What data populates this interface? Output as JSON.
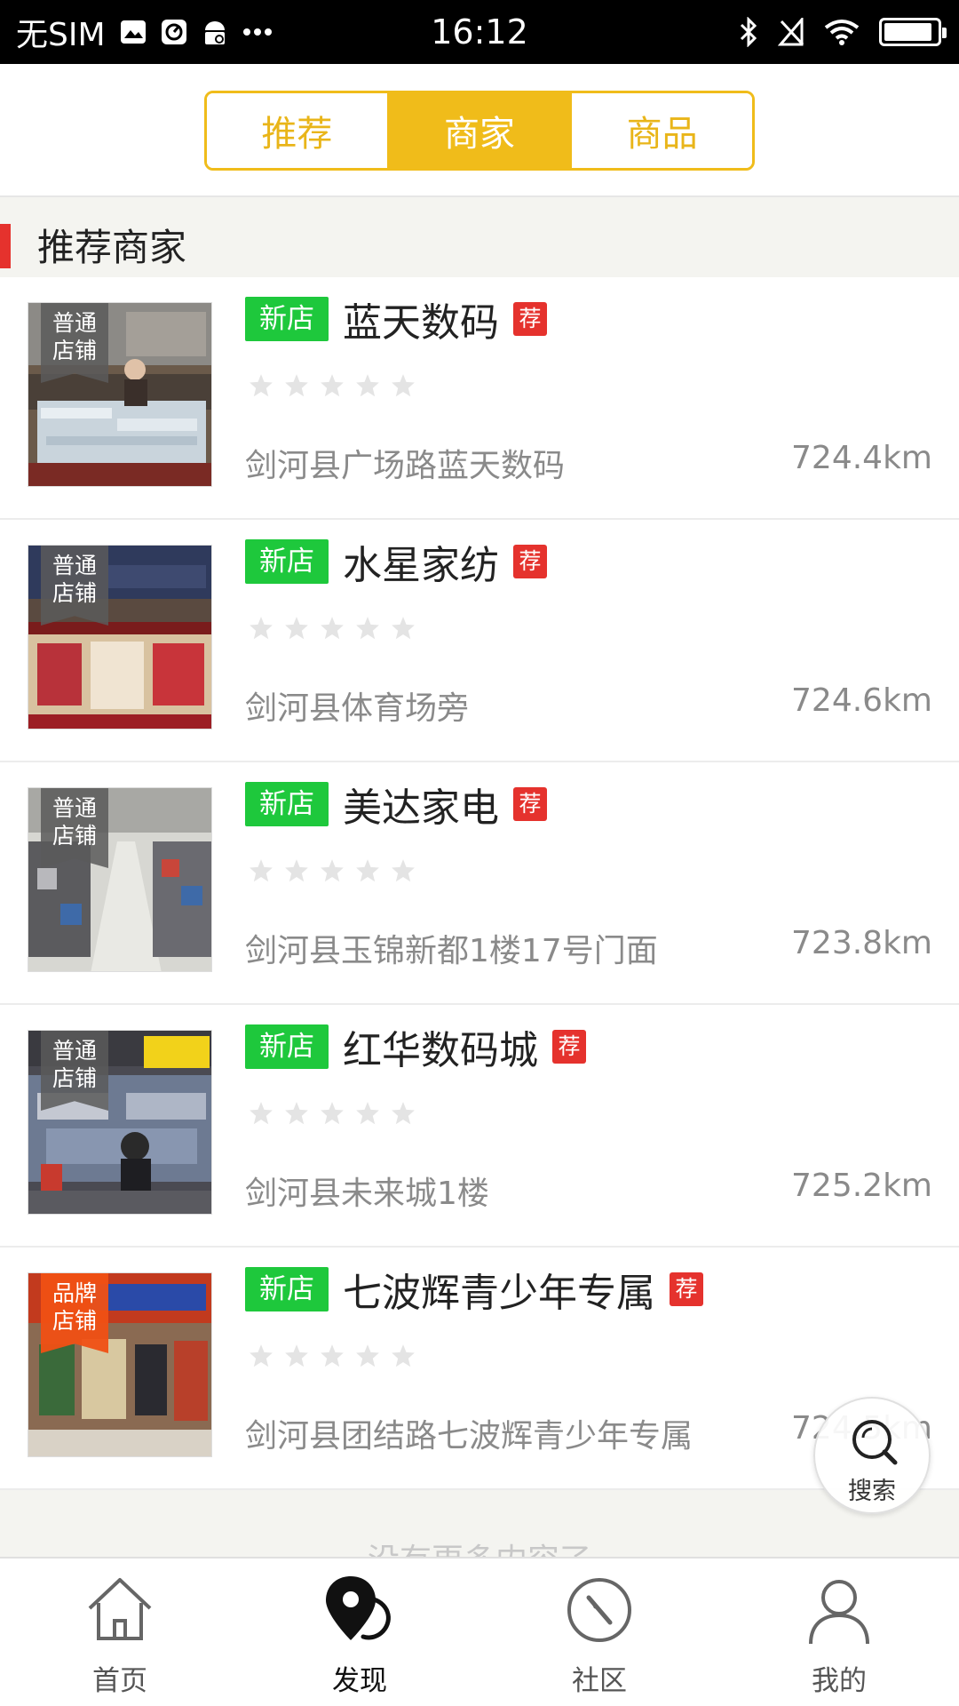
{
  "status_bar": {
    "carrier": "无SIM",
    "time": "16:12",
    "battery_level": 0.92
  },
  "tabs": [
    {
      "label": "推荐",
      "active": false
    },
    {
      "label": "商家",
      "active": true
    },
    {
      "label": "商品",
      "active": false
    }
  ],
  "section": {
    "title": "推荐商家"
  },
  "shops": [
    {
      "ribbon": [
        "普通",
        "店铺"
      ],
      "ribbon_type": "normal",
      "new_label": "新店",
      "name": "蓝天数码",
      "rec_label": "荐",
      "rating": 0,
      "address": "剑河县广场路蓝天数码",
      "distance": "724.4km"
    },
    {
      "ribbon": [
        "普通",
        "店铺"
      ],
      "ribbon_type": "normal",
      "new_label": "新店",
      "name": "水星家纺",
      "rec_label": "荐",
      "rating": 0,
      "address": "剑河县体育场旁",
      "distance": "724.6km"
    },
    {
      "ribbon": [
        "普通",
        "店铺"
      ],
      "ribbon_type": "normal",
      "new_label": "新店",
      "name": "美达家电",
      "rec_label": "荐",
      "rating": 0,
      "address": "剑河县玉锦新都1楼17号门面",
      "distance": "723.8km"
    },
    {
      "ribbon": [
        "普通",
        "店铺"
      ],
      "ribbon_type": "normal",
      "new_label": "新店",
      "name": "红华数码城",
      "rec_label": "荐",
      "rating": 0,
      "address": "剑河县未来城1楼",
      "distance": "725.2km"
    },
    {
      "ribbon": [
        "品牌",
        "店铺"
      ],
      "ribbon_type": "brand",
      "new_label": "新店",
      "name": "七波辉青少年专属",
      "rec_label": "荐",
      "rating": 0,
      "address": "剑河县团结路七波辉青少年专属",
      "distance": "724.5km"
    }
  ],
  "footer_text": "没有更多内容了",
  "search_fab": {
    "label": "搜索",
    "icon": "search-icon"
  },
  "bottom_nav": [
    {
      "label": "首页",
      "icon": "home-icon",
      "active": false
    },
    {
      "label": "发现",
      "icon": "discover-pin-icon",
      "active": true
    },
    {
      "label": "社区",
      "icon": "compass-icon",
      "active": false
    },
    {
      "label": "我的",
      "icon": "user-icon",
      "active": false
    }
  ],
  "colors": {
    "accent": "#f0bc1a",
    "new_badge": "#1ec83c",
    "rec_badge": "#e5322d",
    "section_bar": "#e5322d"
  }
}
